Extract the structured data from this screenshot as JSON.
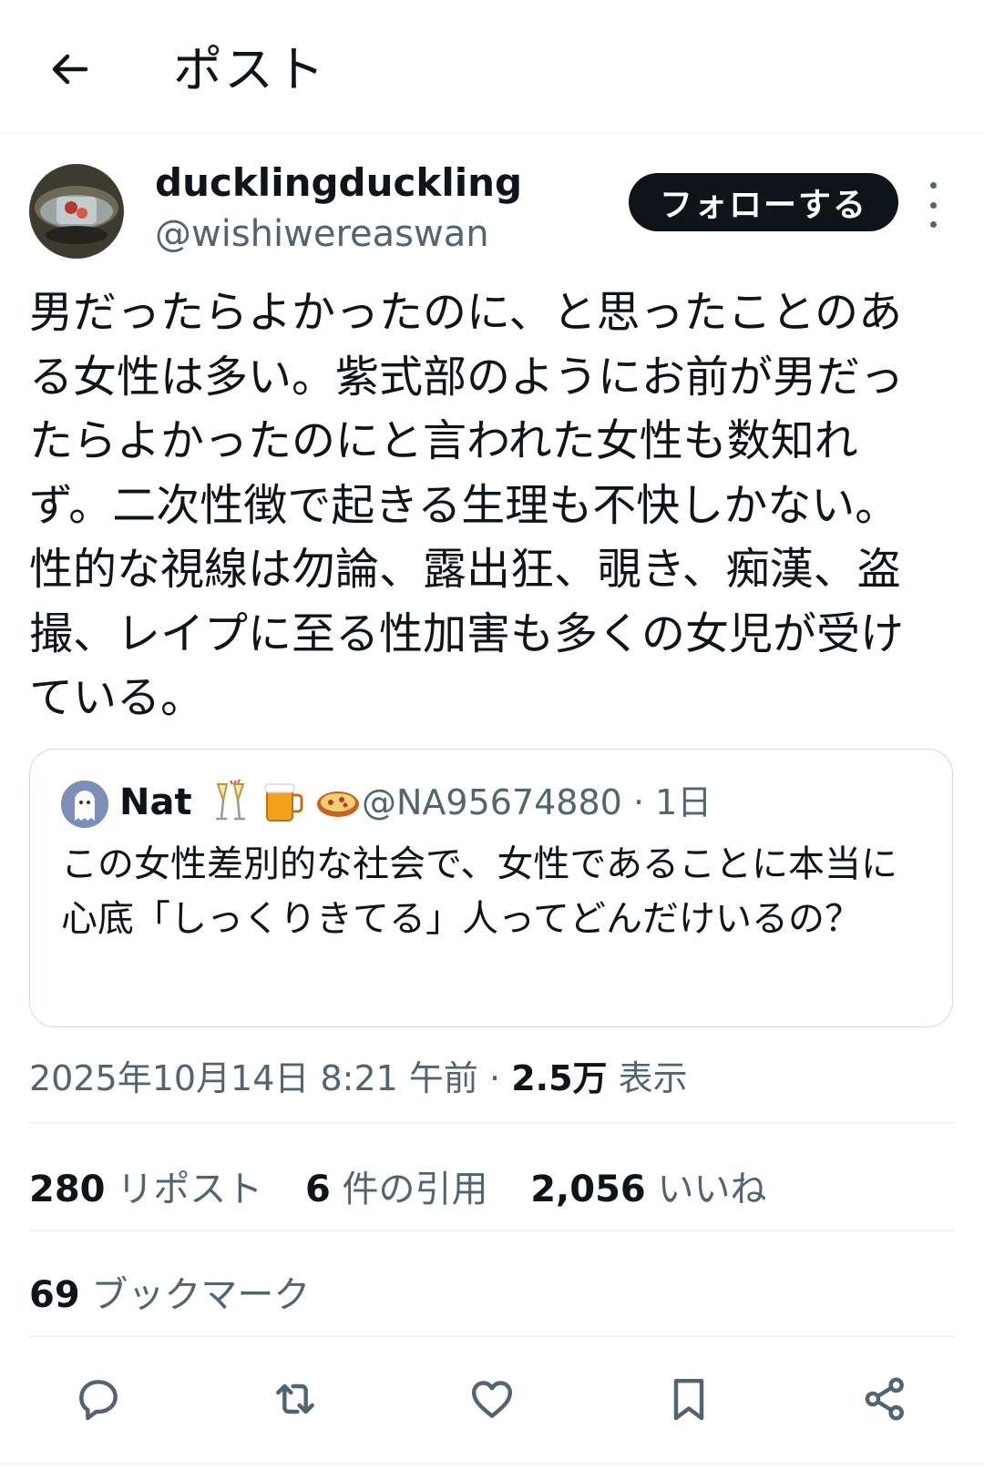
{
  "header": {
    "title": "ポスト"
  },
  "author": {
    "name": "ducklingduckling",
    "handle": "@wishiwereaswan",
    "follow_label": "フォローする"
  },
  "post": {
    "text": "男だったらよかったのに、と思ったことのある女性は多い。紫式部のようにお前が男だったらよかったのにと言われた女性も数知れず。二次性徴で起きる生理も不快しかない。性的な視線は勿論、露出狂、覗き、痴漢、盗撮、レイプに至る性加害も多くの女児が受けている。"
  },
  "quote": {
    "name": "Nat",
    "emojis": [
      "champagne-icon",
      "beer-icon",
      "pizza-icon"
    ],
    "handle": "@NA95674880",
    "sep": "·",
    "time": "1日",
    "text": "この女性差別的な社会で、女性であることに本当に心底「しっくりきてる」人ってどんだけいるの？"
  },
  "meta": {
    "datetime": "2025年10月14日 8:21 午前",
    "sep": "·",
    "views": "2.5万",
    "views_label": "表示"
  },
  "stats": {
    "reposts": "280",
    "reposts_label": "リポスト",
    "quotes": "6",
    "quotes_label": "件の引用",
    "likes": "2,056",
    "likes_label": "いいね",
    "bookmarks": "69",
    "bookmarks_label": "ブックマーク"
  },
  "actions": [
    "reply-icon",
    "repost-icon",
    "like-icon",
    "bookmark-icon",
    "share-icon"
  ],
  "colors": {
    "text": "#0f1419",
    "secondary": "#536471",
    "border": "#cfd9de",
    "button": "#0f1419"
  }
}
